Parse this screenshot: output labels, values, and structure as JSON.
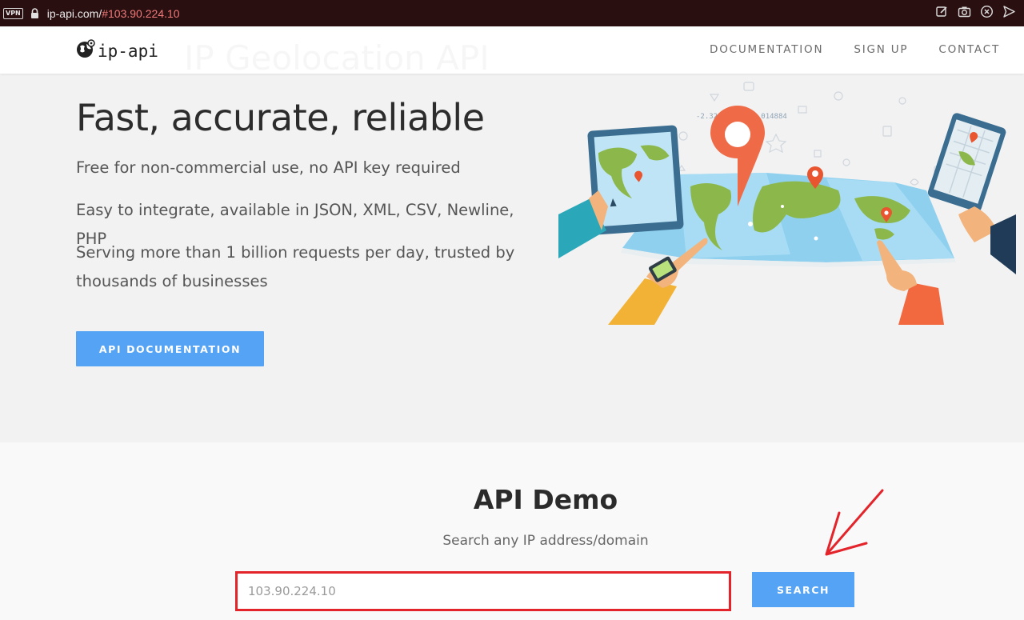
{
  "browser": {
    "vpn_label": "VPN",
    "url_host": "ip-api.com/",
    "url_hash": "#103.90.224.10",
    "actions": [
      "edit-icon",
      "camera-icon",
      "close-circle-icon",
      "send-icon"
    ]
  },
  "nav": {
    "logo_text": "ip-api",
    "ghost_title": "IP Geolocation API",
    "links": [
      "DOCUMENTATION",
      "SIGN UP",
      "CONTACT"
    ]
  },
  "hero": {
    "title": "Fast, accurate, reliable",
    "lines": [
      "Free for non-commercial use, no API key required",
      "Easy to integrate, available in JSON, XML, CSV, Newline, PHP",
      "Serving more than 1 billion requests per day, trusted by thousands of businesses"
    ],
    "button_label": "API DOCUMENTATION",
    "illustration_coords": "-2.329799, -52.014884"
  },
  "demo": {
    "title": "API Demo",
    "subtitle": "Search any IP address/domain",
    "input_placeholder": "103.90.224.10",
    "search_label": "SEARCH"
  },
  "colors": {
    "accent": "#55a3f5",
    "highlight": "#e3242b",
    "browser_bar": "#2a0f11"
  }
}
